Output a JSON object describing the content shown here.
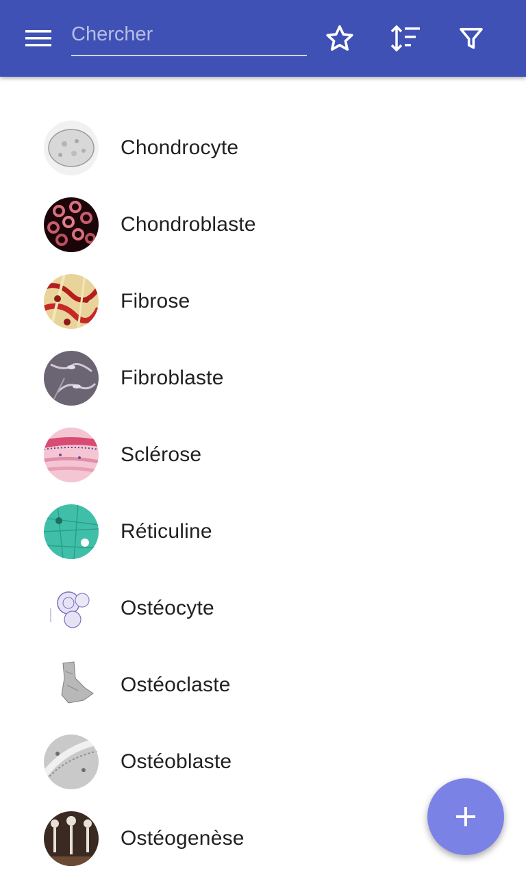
{
  "toolbar": {
    "menu_icon": "hamburger-menu-icon",
    "search_placeholder": "Chercher",
    "search_value": "",
    "favorites_icon": "star-outline-icon",
    "sort_icon": "sort-icon",
    "filter_icon": "filter-icon"
  },
  "items": [
    {
      "label": "Chondrocyte"
    },
    {
      "label": "Chondroblaste"
    },
    {
      "label": "Fibrose"
    },
    {
      "label": "Fibroblaste"
    },
    {
      "label": "Sclérose"
    },
    {
      "label": "Réticuline"
    },
    {
      "label": "Ostéocyte"
    },
    {
      "label": "Ostéoclaste"
    },
    {
      "label": "Ostéoblaste"
    },
    {
      "label": "Ostéogenèse"
    }
  ],
  "fab": {
    "icon": "plus-icon"
  },
  "colors": {
    "primary": "#3f51b5",
    "fab": "#7b82e6",
    "text": "#212121"
  }
}
